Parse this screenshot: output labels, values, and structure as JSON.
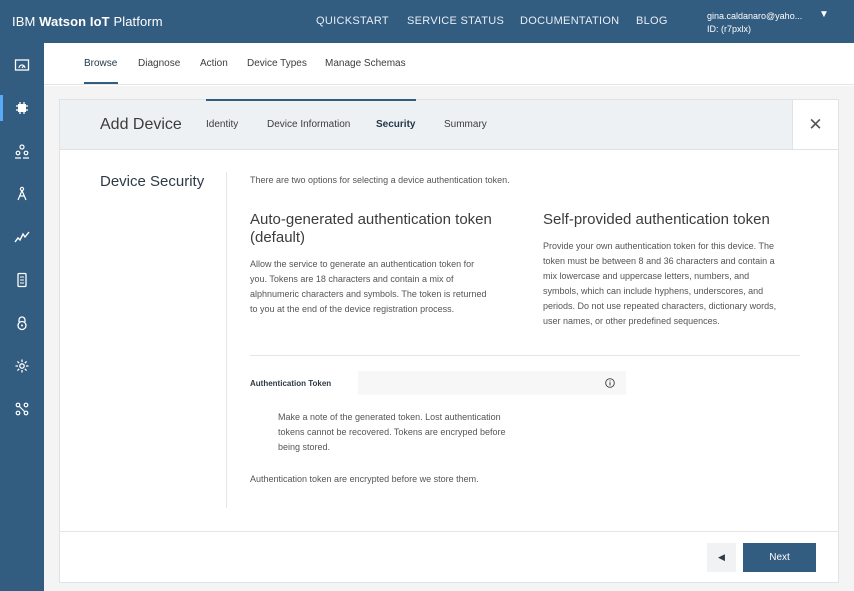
{
  "app": {
    "brand_prefix": "IBM",
    "brand_bold": "Watson IoT",
    "brand_suffix": "Platform"
  },
  "topnav": {
    "items": [
      "QUICKSTART",
      "SERVICE STATUS",
      "DOCUMENTATION",
      "BLOG"
    ]
  },
  "user": {
    "email": "gina.caldanaro@yaho...",
    "id": "ID: (r7pxlx)",
    "caret": "▼"
  },
  "rail": {
    "icons": [
      "boards-icon",
      "devices-icon",
      "members-icon",
      "rules-icon",
      "usage-icon",
      "apps-icon",
      "security-icon",
      "settings-icon",
      "extensions-icon"
    ],
    "active_index": 1
  },
  "subnav": {
    "items": [
      "Browse",
      "Diagnose",
      "Action",
      "Device Types",
      "Manage Schemas"
    ],
    "active": "Browse"
  },
  "modal": {
    "title": "Add Device",
    "steps": [
      "Identity",
      "Device Information",
      "Security",
      "Summary"
    ],
    "current_step": "Security",
    "close": "✕",
    "section_title": "Device Security",
    "intro": "There are two options for selecting a device authentication token.",
    "auto": {
      "heading_line1": "Auto-generated authentication token",
      "heading_line2": "(default)",
      "lines": [
        "Allow the service to generate an authentication token for",
        "you. Tokens are 18 characters and contain a mix of",
        "alphnumeric characters and symbols. The token is returned",
        "to you at the end of the device registration process."
      ]
    },
    "self": {
      "heading": "Self-provided authentication token",
      "lines": [
        "Provide your own authentication token for this device. The",
        "token must be between 8 and 36 characters and contain a",
        "mix lowercase and uppercase letters, numbers, and",
        "symbols, which can include hyphens, underscores, and",
        "periods. Do not use repeated characters, dictionary words,",
        "user names, or other predefined sequences."
      ]
    },
    "token": {
      "label": "Authentication Token",
      "value": "",
      "placeholder": ""
    },
    "note_lines": [
      "Make a note of the generated token. Lost authentication",
      "tokens cannot be recovered. Tokens are encryped before",
      "being stored."
    ],
    "encrypted_note": "Authentication token are encrypted before we store them.",
    "buttons": {
      "back": "◀",
      "next": "Next"
    }
  },
  "colors": {
    "primary": "#325c80",
    "header_bg": "#eef1f3",
    "page_bg": "#f4f4f4"
  }
}
